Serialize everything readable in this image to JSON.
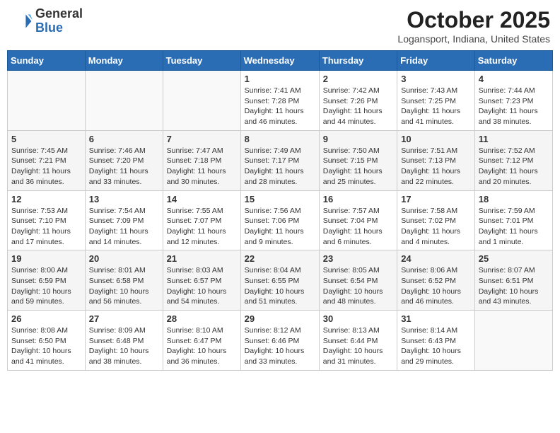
{
  "header": {
    "logo_line1": "General",
    "logo_line2": "Blue",
    "month": "October 2025",
    "location": "Logansport, Indiana, United States"
  },
  "days_of_week": [
    "Sunday",
    "Monday",
    "Tuesday",
    "Wednesday",
    "Thursday",
    "Friday",
    "Saturday"
  ],
  "weeks": [
    [
      {
        "day": "",
        "info": ""
      },
      {
        "day": "",
        "info": ""
      },
      {
        "day": "",
        "info": ""
      },
      {
        "day": "1",
        "info": "Sunrise: 7:41 AM\nSunset: 7:28 PM\nDaylight: 11 hours\nand 46 minutes."
      },
      {
        "day": "2",
        "info": "Sunrise: 7:42 AM\nSunset: 7:26 PM\nDaylight: 11 hours\nand 44 minutes."
      },
      {
        "day": "3",
        "info": "Sunrise: 7:43 AM\nSunset: 7:25 PM\nDaylight: 11 hours\nand 41 minutes."
      },
      {
        "day": "4",
        "info": "Sunrise: 7:44 AM\nSunset: 7:23 PM\nDaylight: 11 hours\nand 38 minutes."
      }
    ],
    [
      {
        "day": "5",
        "info": "Sunrise: 7:45 AM\nSunset: 7:21 PM\nDaylight: 11 hours\nand 36 minutes."
      },
      {
        "day": "6",
        "info": "Sunrise: 7:46 AM\nSunset: 7:20 PM\nDaylight: 11 hours\nand 33 minutes."
      },
      {
        "day": "7",
        "info": "Sunrise: 7:47 AM\nSunset: 7:18 PM\nDaylight: 11 hours\nand 30 minutes."
      },
      {
        "day": "8",
        "info": "Sunrise: 7:49 AM\nSunset: 7:17 PM\nDaylight: 11 hours\nand 28 minutes."
      },
      {
        "day": "9",
        "info": "Sunrise: 7:50 AM\nSunset: 7:15 PM\nDaylight: 11 hours\nand 25 minutes."
      },
      {
        "day": "10",
        "info": "Sunrise: 7:51 AM\nSunset: 7:13 PM\nDaylight: 11 hours\nand 22 minutes."
      },
      {
        "day": "11",
        "info": "Sunrise: 7:52 AM\nSunset: 7:12 PM\nDaylight: 11 hours\nand 20 minutes."
      }
    ],
    [
      {
        "day": "12",
        "info": "Sunrise: 7:53 AM\nSunset: 7:10 PM\nDaylight: 11 hours\nand 17 minutes."
      },
      {
        "day": "13",
        "info": "Sunrise: 7:54 AM\nSunset: 7:09 PM\nDaylight: 11 hours\nand 14 minutes."
      },
      {
        "day": "14",
        "info": "Sunrise: 7:55 AM\nSunset: 7:07 PM\nDaylight: 11 hours\nand 12 minutes."
      },
      {
        "day": "15",
        "info": "Sunrise: 7:56 AM\nSunset: 7:06 PM\nDaylight: 11 hours\nand 9 minutes."
      },
      {
        "day": "16",
        "info": "Sunrise: 7:57 AM\nSunset: 7:04 PM\nDaylight: 11 hours\nand 6 minutes."
      },
      {
        "day": "17",
        "info": "Sunrise: 7:58 AM\nSunset: 7:02 PM\nDaylight: 11 hours\nand 4 minutes."
      },
      {
        "day": "18",
        "info": "Sunrise: 7:59 AM\nSunset: 7:01 PM\nDaylight: 11 hours\nand 1 minute."
      }
    ],
    [
      {
        "day": "19",
        "info": "Sunrise: 8:00 AM\nSunset: 6:59 PM\nDaylight: 10 hours\nand 59 minutes."
      },
      {
        "day": "20",
        "info": "Sunrise: 8:01 AM\nSunset: 6:58 PM\nDaylight: 10 hours\nand 56 minutes."
      },
      {
        "day": "21",
        "info": "Sunrise: 8:03 AM\nSunset: 6:57 PM\nDaylight: 10 hours\nand 54 minutes."
      },
      {
        "day": "22",
        "info": "Sunrise: 8:04 AM\nSunset: 6:55 PM\nDaylight: 10 hours\nand 51 minutes."
      },
      {
        "day": "23",
        "info": "Sunrise: 8:05 AM\nSunset: 6:54 PM\nDaylight: 10 hours\nand 48 minutes."
      },
      {
        "day": "24",
        "info": "Sunrise: 8:06 AM\nSunset: 6:52 PM\nDaylight: 10 hours\nand 46 minutes."
      },
      {
        "day": "25",
        "info": "Sunrise: 8:07 AM\nSunset: 6:51 PM\nDaylight: 10 hours\nand 43 minutes."
      }
    ],
    [
      {
        "day": "26",
        "info": "Sunrise: 8:08 AM\nSunset: 6:50 PM\nDaylight: 10 hours\nand 41 minutes."
      },
      {
        "day": "27",
        "info": "Sunrise: 8:09 AM\nSunset: 6:48 PM\nDaylight: 10 hours\nand 38 minutes."
      },
      {
        "day": "28",
        "info": "Sunrise: 8:10 AM\nSunset: 6:47 PM\nDaylight: 10 hours\nand 36 minutes."
      },
      {
        "day": "29",
        "info": "Sunrise: 8:12 AM\nSunset: 6:46 PM\nDaylight: 10 hours\nand 33 minutes."
      },
      {
        "day": "30",
        "info": "Sunrise: 8:13 AM\nSunset: 6:44 PM\nDaylight: 10 hours\nand 31 minutes."
      },
      {
        "day": "31",
        "info": "Sunrise: 8:14 AM\nSunset: 6:43 PM\nDaylight: 10 hours\nand 29 minutes."
      },
      {
        "day": "",
        "info": ""
      }
    ]
  ]
}
